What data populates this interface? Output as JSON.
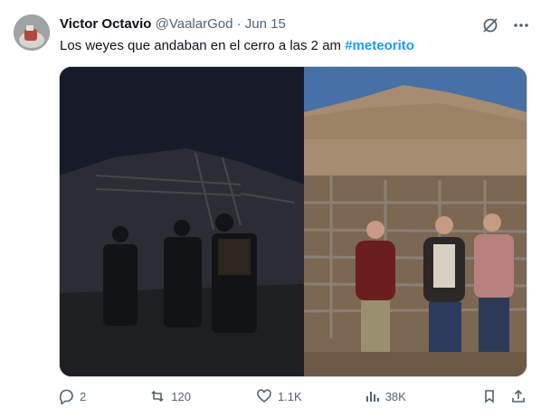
{
  "author": {
    "name": "Victor Octavio",
    "handle": "@VaalarGod",
    "date": "Jun 15"
  },
  "tweet": {
    "text": "Los weyes que andaban en el cerro a las 2 am ",
    "hashtag": "#meteorito"
  },
  "top_icons": [
    "grok-icon",
    "more-icon"
  ],
  "actions": {
    "replies": "2",
    "reposts": "120",
    "likes": "1.1K",
    "views": "38K"
  },
  "colors": {
    "hashtag": "#1d9bf0",
    "muted": "#536471"
  }
}
